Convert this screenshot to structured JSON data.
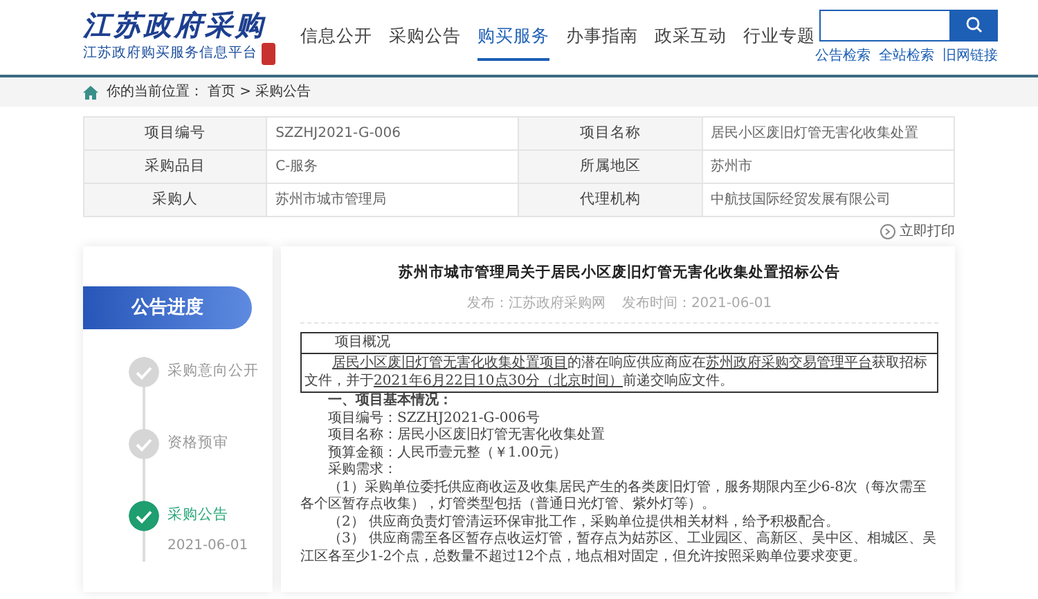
{
  "header": {
    "logo_title": "江苏政府采购",
    "logo_subtitle": "江苏政府购买服务信息平台",
    "nav": [
      {
        "label": "信息公开",
        "selected": false
      },
      {
        "label": "采购公告",
        "selected": false
      },
      {
        "label": "购买服务",
        "selected": true
      },
      {
        "label": "办事指南",
        "selected": false
      },
      {
        "label": "政采互动",
        "selected": false
      },
      {
        "label": "行业专题",
        "selected": false
      }
    ],
    "search": {
      "links": [
        "公告检索",
        "全站检索",
        "旧网链接"
      ]
    }
  },
  "breadcrumb": {
    "label": "你的当前位置：",
    "path": "首页 > 采购公告"
  },
  "info_table": {
    "rows": [
      {
        "cells": [
          "项目编号",
          "SZZHJ2021-G-006",
          "项目名称",
          "居民小区废旧灯管无害化收集处置"
        ]
      },
      {
        "cells": [
          "采购品目",
          "C-服务",
          "所属地区",
          "苏州市"
        ]
      },
      {
        "cells": [
          "采购人",
          "苏州市城市管理局",
          "代理机构",
          "中航技国际经贸发展有限公司"
        ]
      }
    ]
  },
  "print_link": "立即打印",
  "sidebar": {
    "title": "公告进度",
    "steps": [
      {
        "label": "采购意向公开",
        "current": false
      },
      {
        "label": "资格预审",
        "current": false
      },
      {
        "label": "采购公告",
        "current": true,
        "date": "2021-06-01"
      }
    ]
  },
  "article": {
    "title": "苏州市城市管理局关于居民小区废旧灯管无害化收集处置招标公告",
    "source": "发布：江苏政府采购网",
    "published": "发布时间：2021-06-01",
    "overview": {
      "heading": "项目概况",
      "segments": [
        {
          "text": "居民小区废旧灯管无害化收集处置项目",
          "underlined": true
        },
        {
          "text": "的潜在响应供应商应在",
          "underlined": false
        },
        {
          "text": "苏州政府采购交易管理平台",
          "underlined": true
        },
        {
          "text": "获取招标文件，并于",
          "underlined": false
        },
        {
          "text": "2021年6月22日10点30分（北京时间）",
          "underlined": true
        },
        {
          "text": "前递交响应文件。",
          "underlined": false
        }
      ]
    },
    "paragraphs": [
      {
        "kind": "heading",
        "text": "一、项目基本情况："
      },
      {
        "kind": "line",
        "text": "项目编号：SZZHJ2021-G-006号"
      },
      {
        "kind": "line",
        "text": "项目名称：居民小区废旧灯管无害化收集处置"
      },
      {
        "kind": "line",
        "text": "预算金额：人民币壹元整（￥1.00元）"
      },
      {
        "kind": "line",
        "text": "采购需求："
      },
      {
        "kind": "para",
        "text": "（1）采购单位委托供应商收运及收集居民产生的各类废旧灯管，服务期限内至少6-8次（每次需至各个区暂存点收集），灯管类型包括（普通日光灯管、紫外灯等）。"
      },
      {
        "kind": "para",
        "text": "（2） 供应商负责灯管清运环保审批工作，采购单位提供相关材料，给予积极配合。"
      },
      {
        "kind": "para",
        "text": "（3） 供应商需至各区暂存点收运灯管，暂存点为姑苏区、工业园区、高新区、吴中区、相城区、吴江区各至少1-2个点，总数量不超过12个点，地点相对固定，但允许按照采购单位要求变更。"
      }
    ]
  }
}
